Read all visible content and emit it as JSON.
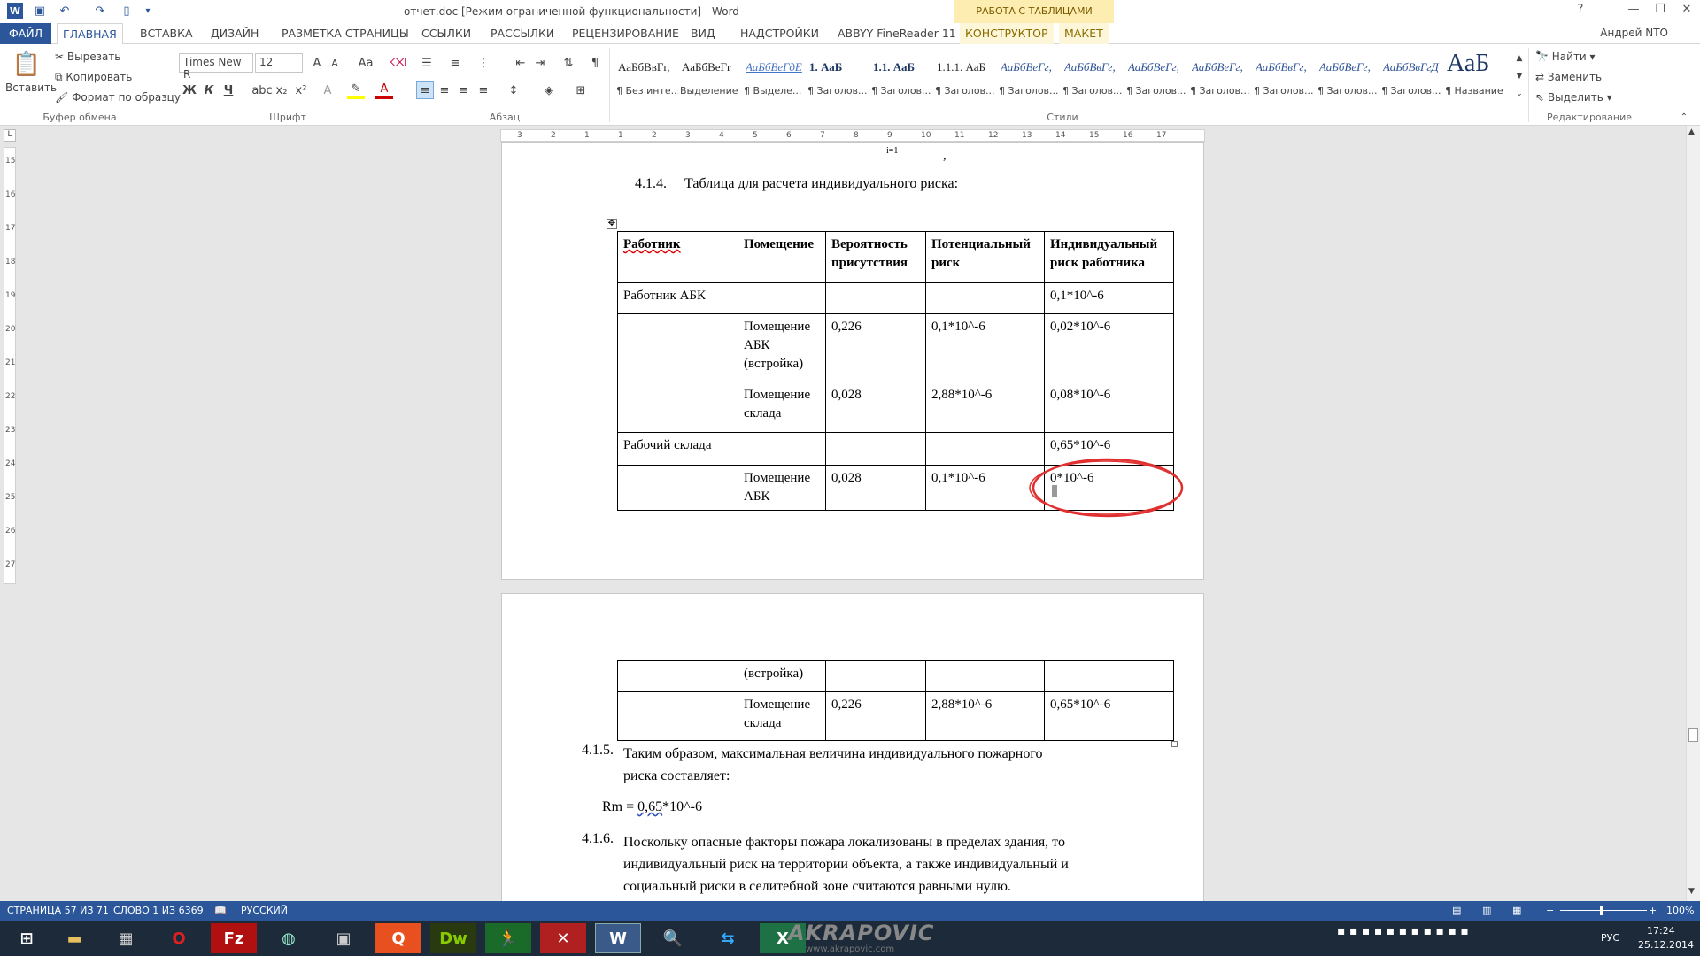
{
  "window": {
    "title": "отчет.doc [Режим ограниченной функциональности] - Word",
    "context_group": "РАБОТА С ТАБЛИЦАМИ",
    "user": "Андрей NTO",
    "controls": [
      "?",
      "—",
      "❐",
      "✕"
    ]
  },
  "quick_access": [
    "save-icon",
    "undo-icon",
    "redo-icon",
    "new-doc-icon"
  ],
  "tabs": [
    {
      "label": "ФАЙЛ"
    },
    {
      "label": "ГЛАВНАЯ"
    },
    {
      "label": "ВСТАВКА"
    },
    {
      "label": "ДИЗАЙН"
    },
    {
      "label": "РАЗМЕТКА СТРАНИЦЫ"
    },
    {
      "label": "ССЫЛКИ"
    },
    {
      "label": "РАССЫЛКИ"
    },
    {
      "label": "РЕЦЕНЗИРОВАНИЕ"
    },
    {
      "label": "ВИД"
    },
    {
      "label": "НАДСТРОЙКИ"
    },
    {
      "label": "ABBYY FineReader 11"
    },
    {
      "label": "КОНСТРУКТОР"
    },
    {
      "label": "МАКЕТ"
    }
  ],
  "ribbon": {
    "clipboard": {
      "paste": "Вставить",
      "cut": "Вырезать",
      "copy": "Копировать",
      "format_painter": "Формат по образцу",
      "label": "Буфер обмена"
    },
    "font": {
      "name": "Times New R",
      "size": "12",
      "label": "Шрифт",
      "bold": "Ж",
      "italic": "К",
      "underline": "Ч",
      "sub": "x₂",
      "sup": "x²",
      "case": "Aa"
    },
    "paragraph": {
      "label": "Абзац",
      "pilcrow": "¶"
    },
    "styles": {
      "label": "Стили",
      "items": [
        {
          "sample": "АаБбВвГг,",
          "name": "¶ Без инте..."
        },
        {
          "sample": "АаБбВеГг",
          "name": "Выделение"
        },
        {
          "sample": "АаБбВеГдЕ",
          "name": "¶ Выделе..."
        },
        {
          "sample": "1. АаБ",
          "name": "¶ Заголов..."
        },
        {
          "sample": "1.1. АаБ",
          "name": "¶ Заголов..."
        },
        {
          "sample": "1.1.1. АаБ",
          "name": "¶ Заголов..."
        },
        {
          "sample": "АаБбВеГг,",
          "name": "¶ Заголов..."
        },
        {
          "sample": "АаБбВвГг,",
          "name": "¶ Заголов..."
        },
        {
          "sample": "АаБбВеГг,",
          "name": "¶ Заголов..."
        },
        {
          "sample": "АаБбВеГг,",
          "name": "¶ Заголов..."
        },
        {
          "sample": "АаБбВвГг,",
          "name": "¶ Заголов..."
        },
        {
          "sample": "АаБбВеГг,",
          "name": "¶ Заголов..."
        },
        {
          "sample": "АаБбВвГгД",
          "name": "¶ Заголов..."
        },
        {
          "sample": "АаБ",
          "name": "¶ Название"
        }
      ]
    },
    "editing": {
      "find": "Найти",
      "replace": "Заменить",
      "select": "Выделить",
      "label": "Редактирование"
    }
  },
  "ruler": {
    "h_ticks": [
      "3",
      "2",
      "1",
      "1",
      "2",
      "3",
      "4",
      "5",
      "6",
      "7",
      "8",
      "9",
      "10",
      "11",
      "12",
      "13",
      "14",
      "15",
      "16",
      "17"
    ],
    "v_ticks": [
      "15",
      "16",
      "17",
      "18",
      "19",
      "20",
      "21",
      "22",
      "23",
      "24",
      "25",
      "26",
      "27"
    ]
  },
  "document": {
    "page1_top_marks": [
      "i=1",
      ","
    ],
    "heading_num": "4.1.4.",
    "heading_text": "Таблица для расчета индивидуального риска:",
    "table_header": [
      "Работник",
      "Помещение",
      "Вероятность присутствия",
      "Потенциальный риск",
      "Индивидуальный риск работника"
    ],
    "table_rows": [
      [
        "Работник АБК",
        "",
        "",
        "",
        "0,1*10^-6"
      ],
      [
        "",
        "Помещение АБК (встройка)",
        "0,226",
        "0,1*10^-6",
        "0,02*10^-6"
      ],
      [
        "",
        "Помещение склада",
        "0,028",
        "2,88*10^-6",
        "0,08*10^-6"
      ],
      [
        "Рабочий склада",
        "",
        "",
        "",
        "0,65*10^-6"
      ],
      [
        "",
        "Помещение АБК",
        "0,028",
        "0,1*10^-6",
        "0*10^-6"
      ]
    ],
    "table_rows_page2": [
      [
        "",
        "(встройка)",
        "",
        "",
        ""
      ],
      [
        "",
        "Помещение склада",
        "0,226",
        "2,88*10^-6",
        "0,65*10^-6"
      ]
    ],
    "p415_num": "4.1.5.",
    "p415_line1": "Таким образом, максимальная величина индивидуального пожарного",
    "p415_line2": "риска составляет:",
    "formula_prefix": "Rm = ",
    "formula_value": "0,65",
    "formula_suffix": "*10^-6",
    "p416_num": "4.1.6.",
    "p416_line1": "Поскольку опасные факторы пожара локализованы в пределах здания, то",
    "p416_line2": "индивидуальный риск на территории объекта, а также индивидуальный и",
    "p416_line3": "социальный риски в селитебной зоне считаются равными нулю."
  },
  "status": {
    "page": "СТРАНИЦА 57 ИЗ 71",
    "words": "СЛОВО 1 ИЗ 6369",
    "language": "РУССКИЙ",
    "zoom": "100%"
  },
  "taskbar": {
    "apps": [
      "start",
      "explorer",
      "calculator",
      "opera",
      "filezilla",
      "paint",
      "scanner",
      "qip",
      "dreamweaver",
      "runner",
      "app-red",
      "word",
      "search",
      "teamviewer",
      "excel"
    ],
    "watermark": "AKRAPOVIC",
    "watermark_url": "www.akrapovic.com",
    "lang": "РУС",
    "time": "17:24",
    "date": "25.12.2014"
  },
  "colors": {
    "accent": "#2b579a",
    "annotation": "#e03030",
    "context_tab": "#fdedb0"
  }
}
